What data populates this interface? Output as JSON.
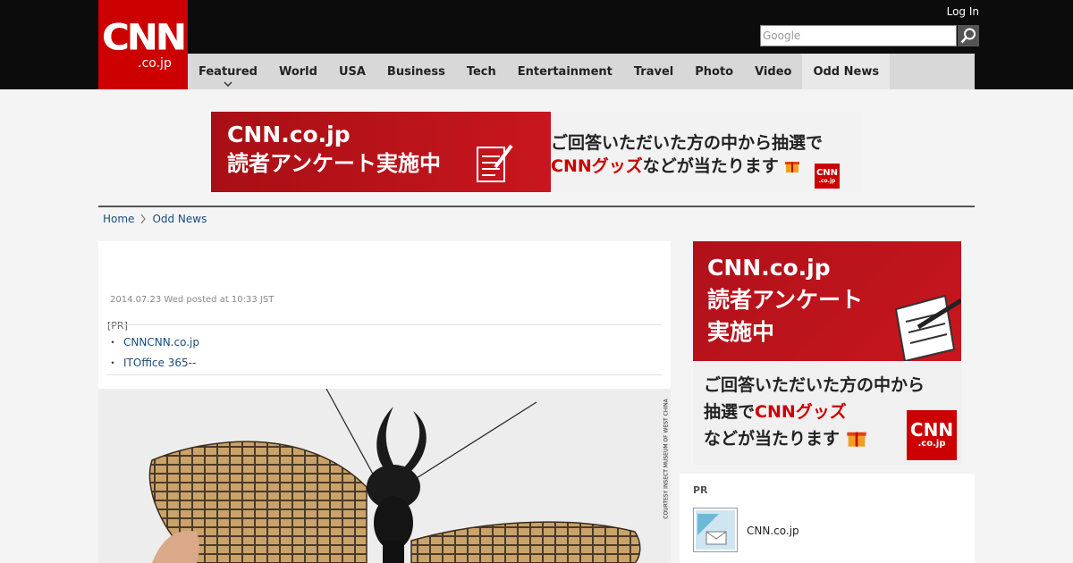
{
  "header": {
    "logo_main": "CNN",
    "logo_sub": ".co.jp",
    "login_label": "Log In",
    "search_placeholder": "Google"
  },
  "nav": {
    "items": [
      {
        "label": "Featured"
      },
      {
        "label": "World"
      },
      {
        "label": "USA"
      },
      {
        "label": "Business"
      },
      {
        "label": "Tech"
      },
      {
        "label": "Entertainment"
      },
      {
        "label": "Travel"
      },
      {
        "label": "Photo"
      },
      {
        "label": "Video"
      },
      {
        "label": "Odd News"
      }
    ],
    "active": "Odd News"
  },
  "banner": {
    "line1": "CNN.co.jp",
    "line2": "読者アンケート実施中",
    "right_line1": "ご回答いただいた方の中から抽選で",
    "right_red": "CNNグッズ",
    "right_line2_rest": "などが当たります",
    "logo_main": "CNN",
    "logo_sub": ".co.jp"
  },
  "breadcrumb": {
    "home": "Home",
    "current": "Odd News"
  },
  "article": {
    "dateline": "2014.07.23 Wed posted at 10:33 JST",
    "pr_label": "[PR]",
    "pr_links": [
      "CNNCNN.co.jp",
      "ITOffice 365--"
    ],
    "photo_credit": "COURTESY INSECT MUSEUM OF WEST CHINA"
  },
  "side_ad": {
    "line1": "CNN.co.jp",
    "line2": "読者アンケート",
    "line3": "実施中",
    "b1": "ご回答いただいた方の中から",
    "b2_pre": "抽選で",
    "b2_red": "CNNグッズ",
    "b3": "などが当たります",
    "logo_main": "CNN",
    "logo_sub": ".co.jp"
  },
  "pr_box": {
    "label": "PR",
    "item_name": "CNN.co.jp"
  },
  "colors": {
    "brand_red": "#cc0000",
    "header_bg": "#0c0c0c",
    "nav_bg": "#d8d8d8",
    "link": "#1a4d80"
  }
}
